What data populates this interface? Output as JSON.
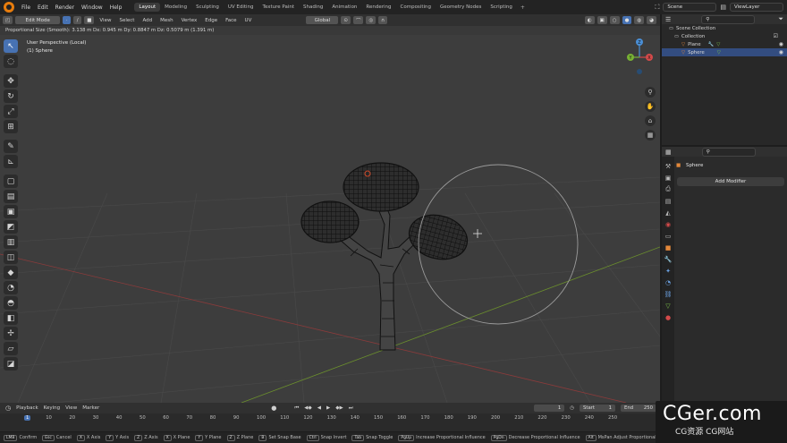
{
  "app": {
    "menu": [
      "File",
      "Edit",
      "Render",
      "Window",
      "Help"
    ],
    "workspaces": [
      "Layout",
      "Modeling",
      "Sculpting",
      "UV Editing",
      "Texture Paint",
      "Shading",
      "Animation",
      "Rendering",
      "Compositing",
      "Geometry Nodes",
      "Scripting"
    ],
    "active_workspace": "Layout",
    "scene": "Scene",
    "view_layer": "ViewLayer"
  },
  "viewport": {
    "mode": "Edit Mode",
    "menus": [
      "View",
      "Select",
      "Add",
      "Mesh",
      "Vertex",
      "Edge",
      "Face",
      "UV"
    ],
    "transform_orientation": "Global",
    "proportional_info": "Proportional Size (Smooth): 3.138 m   Dx: 0.945 m  Dy: 0.8847 m  Dz: 0.5079 m (1.391 m)",
    "perspective": "User Perspective (Local)",
    "object_label": "(1) Sphere",
    "gizmo_axes": {
      "z": "Z",
      "y": "Y",
      "x": "X"
    }
  },
  "outliner": {
    "rows": [
      {
        "label": "Scene Collection"
      },
      {
        "label": "Collection"
      },
      {
        "label": "Plane"
      },
      {
        "label": "Sphere"
      }
    ]
  },
  "properties": {
    "object_name": "Sphere",
    "add_modifier": "Add Modifier"
  },
  "timeline": {
    "menus": [
      "Playback",
      "Keying",
      "View",
      "Marker"
    ],
    "current_frame": "1",
    "start_label": "Start",
    "start": "1",
    "end_label": "End",
    "end": "250",
    "ticks": [
      "1",
      "10",
      "20",
      "30",
      "40",
      "50",
      "60",
      "70",
      "80",
      "90",
      "100",
      "110",
      "120",
      "130",
      "140",
      "150",
      "160",
      "170",
      "180",
      "190",
      "200",
      "210",
      "220",
      "230",
      "240",
      "250"
    ]
  },
  "statusbar": [
    {
      "key": "LMB",
      "label": "Confirm"
    },
    {
      "key": "Esc",
      "label": "Cancel"
    },
    {
      "key": "X",
      "label": "X Axis"
    },
    {
      "key": "Y",
      "label": "Y Axis"
    },
    {
      "key": "Z",
      "label": "Z Axis"
    },
    {
      "key": "X",
      "label": "X Plane"
    },
    {
      "key": "Y",
      "label": "Y Plane"
    },
    {
      "key": "Z",
      "label": "Z Plane"
    },
    {
      "key": "B",
      "label": "Set Snap Base"
    },
    {
      "key": "Ctrl",
      "label": "Snap Invert"
    },
    {
      "key": "Tab",
      "label": "Snap Toggle"
    },
    {
      "key": "PgUp",
      "label": "Increase Proportional Influence"
    },
    {
      "key": "PgDn",
      "label": "Decrease Proportional Influence"
    },
    {
      "key": "Alt",
      "label": "MsPan Adjust Proportional Influence"
    }
  ],
  "watermark": {
    "big": "CGer.com",
    "small": "CG资源  CG网站"
  }
}
